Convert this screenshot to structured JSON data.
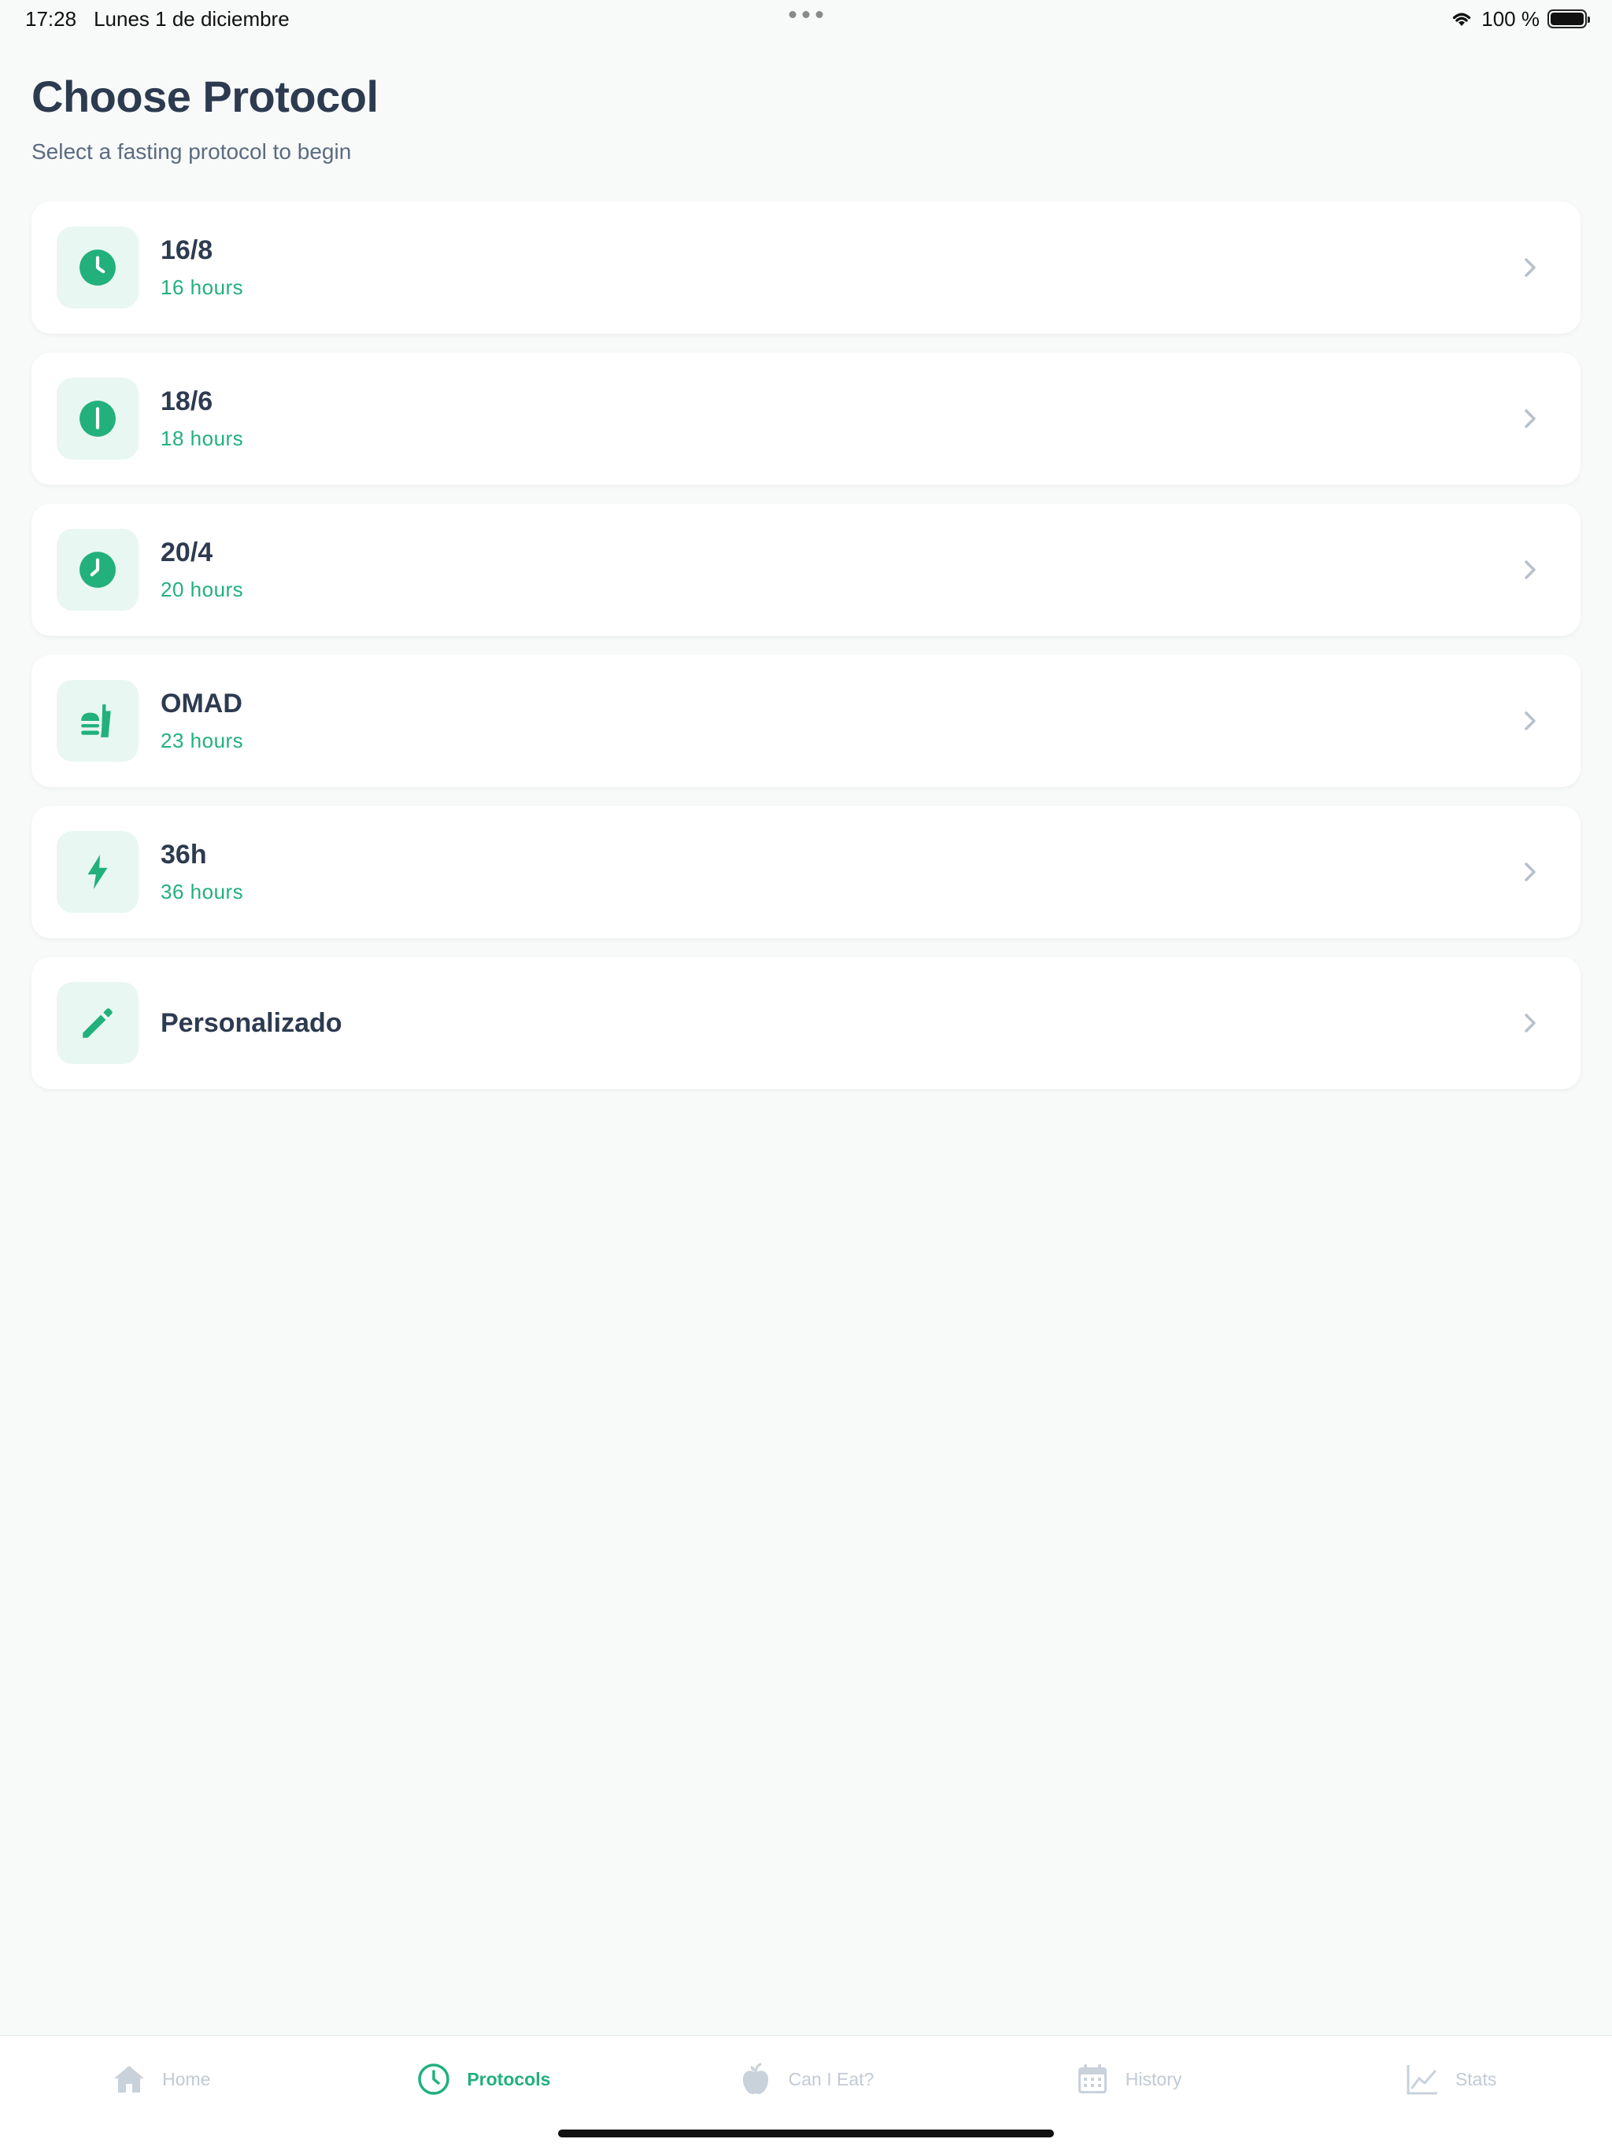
{
  "status_bar": {
    "time": "17:28",
    "date": "Lunes 1 de diciembre",
    "battery": "100 %",
    "battery_level": 1.0
  },
  "header": {
    "title": "Choose Protocol",
    "subtitle": "Select a fasting protocol to begin"
  },
  "protocols": [
    {
      "title": "16/8",
      "subtitle": "16 hours",
      "icon": "clock-icon"
    },
    {
      "title": "18/6",
      "subtitle": "18 hours",
      "icon": "clock-six-icon"
    },
    {
      "title": "20/4",
      "subtitle": "20 hours",
      "icon": "clock-eight-icon"
    },
    {
      "title": "OMAD",
      "subtitle": "23 hours",
      "icon": "meal-icon"
    },
    {
      "title": "36h",
      "subtitle": "36 hours",
      "icon": "lightning-icon"
    },
    {
      "title": "Personalizado",
      "subtitle": "",
      "icon": "pencil-icon"
    }
  ],
  "tabs": [
    {
      "label": "Home",
      "icon": "home-icon",
      "active": false
    },
    {
      "label": "Protocols",
      "icon": "clock-icon",
      "active": true
    },
    {
      "label": "Can I Eat?",
      "icon": "apple-icon",
      "active": false
    },
    {
      "label": "History",
      "icon": "calendar-icon",
      "active": false
    },
    {
      "label": "Stats",
      "icon": "chart-icon",
      "active": false
    }
  ],
  "colors": {
    "accent": "#22b07d",
    "icon_tile_bg": "#e8f7f1",
    "title": "#2d3b50",
    "subtitle": "#5b6b80",
    "inactive_tab": "#c2cad3",
    "background": "#f8faf9"
  }
}
